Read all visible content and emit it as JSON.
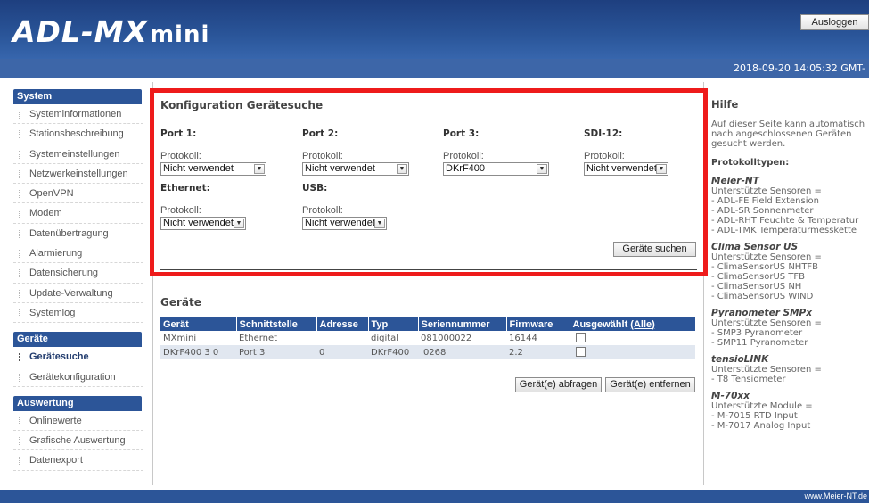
{
  "header": {
    "logo_main": "ADL-MX",
    "logo_sub": "mini",
    "logout_label": "Ausloggen",
    "datetime": "2018-09-20 14:05:32 GMT-"
  },
  "sidebar": {
    "groups": [
      {
        "title": "System",
        "items": [
          "Systeminformationen",
          "Stationsbeschreibung",
          "Systemeinstellungen",
          "Netzwerkeinstellungen",
          "OpenVPN",
          "Modem",
          "Datenübertragung",
          "Alarmierung",
          "Datensicherung",
          "Update-Verwaltung",
          "Systemlog"
        ]
      },
      {
        "title": "Geräte",
        "items": [
          "Gerätesuche",
          "Gerätekonfiguration"
        ],
        "active": "Gerätesuche"
      },
      {
        "title": "Auswertung",
        "items": [
          "Onlinewerte",
          "Grafische Auswertung",
          "Datenexport"
        ]
      }
    ]
  },
  "config": {
    "title": "Konfiguration Gerätesuche",
    "protocol_label": "Protokoll:",
    "ports": [
      {
        "title": "Port 1:",
        "value": "Nicht verwendet"
      },
      {
        "title": "Port 2:",
        "value": "Nicht verwendet"
      },
      {
        "title": "Port 3:",
        "value": "DKrF400"
      },
      {
        "title": "SDI-12:",
        "value": "Nicht verwendet"
      },
      {
        "title": "Ethernet:",
        "value": "Nicht verwendet"
      },
      {
        "title": "USB:",
        "value": "Nicht verwendet"
      }
    ],
    "search_button": "Geräte suchen"
  },
  "devices": {
    "title": "Geräte",
    "columns": [
      "Gerät",
      "Schnittstelle",
      "Adresse",
      "Typ",
      "Seriennummer",
      "Firmware",
      "Ausgewählt"
    ],
    "select_all_label": "(Alle)",
    "rows": [
      {
        "geraet": "MXmini",
        "schnittstelle": "Ethernet",
        "adresse": "",
        "typ": "digital",
        "seriennummer": "081000022",
        "firmware": "16144",
        "selected": false
      },
      {
        "geraet": "DKrF400 3 0",
        "schnittstelle": "Port 3",
        "adresse": "0",
        "typ": "DKrF400",
        "seriennummer": "I0268",
        "firmware": "2.2",
        "selected": false
      }
    ],
    "query_button": "Gerät(e) abfragen",
    "remove_button": "Gerät(e) entfernen"
  },
  "help": {
    "title": "Hilfe",
    "intro": "Auf dieser Seite kann automatisch nach angeschlossenen Geräten gesucht werden.",
    "subtitle": "Protokolltypen:",
    "sections": [
      {
        "name": "Meier-NT",
        "lines": [
          "Unterstützte Sensoren =",
          "- ADL-FE Field Extension",
          "- ADL-SR Sonnenmeter",
          "- ADL-RHT Feuchte & Temperatur",
          "- ADL-TMK Temperaturmesskette"
        ]
      },
      {
        "name": "Clima Sensor US",
        "lines": [
          "Unterstützte Sensoren =",
          "- ClimaSensorUS NHTFB",
          "- ClimaSensorUS TFB",
          "- ClimaSensorUS NH",
          "- ClimaSensorUS WIND"
        ]
      },
      {
        "name": "Pyranometer SMPx",
        "lines": [
          "Unterstützte Sensoren =",
          "- SMP3 Pyranometer",
          "- SMP11 Pyranometer"
        ]
      },
      {
        "name": "tensioLINK",
        "lines": [
          "Unterstützte Sensoren =",
          "- T8 Tensiometer"
        ]
      },
      {
        "name": "M-70xx",
        "lines": [
          "Unterstützte Module =",
          "- M-7015 RTD Input",
          "- M-7017 Analog Input"
        ]
      }
    ]
  },
  "footer": {
    "text": "www.Meier-NT.de"
  },
  "colors": {
    "brand_blue": "#2c5598",
    "highlight_red": "#ee1b1b"
  }
}
